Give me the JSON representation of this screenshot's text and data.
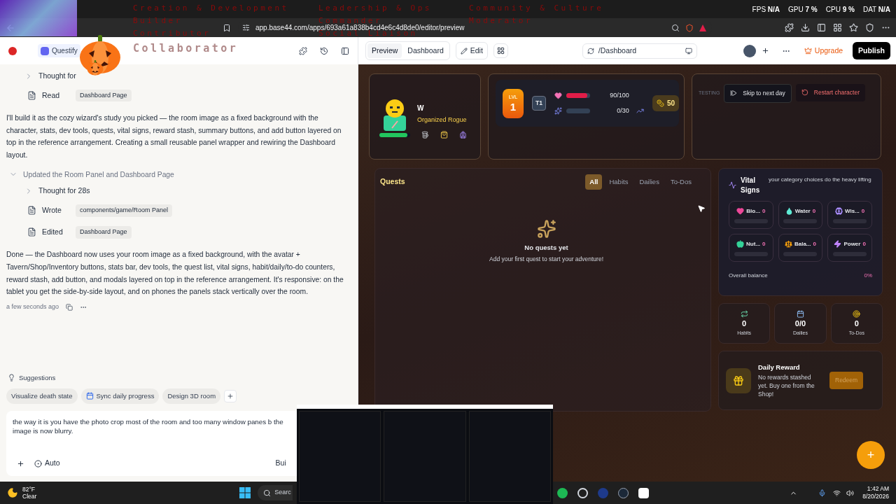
{
  "browser": {
    "perf": [
      {
        "label": "FPS",
        "value": "N/A"
      },
      {
        "label": "GPU",
        "value": "7 %"
      },
      {
        "label": "CPU",
        "value": "9 %"
      },
      {
        "label": "DAT",
        "value": "N/A"
      }
    ],
    "url": "app.base44.com/apps/693a61a838b4cd4e6c4d8de0/editor/preview"
  },
  "overlay": {
    "rows": [
      [
        "Creation & Development",
        "Leadership & Ops",
        "Community & Culture"
      ],
      [
        "Builder",
        "Commander",
        "Moderator"
      ],
      [
        "Contributor",
        "Social Liaison"
      ]
    ],
    "highlight": "Collaborator"
  },
  "appbar": {
    "project": "Questify",
    "view_toggle": [
      {
        "label": "Preview",
        "selected": true
      },
      {
        "label": "Dashboard",
        "selected": false
      }
    ],
    "edit": "Edit",
    "route": "/Dashboard",
    "upgrade": "Upgrade",
    "publish": "Publish"
  },
  "chat": {
    "items": [
      {
        "kind": "step",
        "label": "Thought for",
        "expanded": false
      },
      {
        "kind": "file",
        "action": "Read",
        "file": "Dashboard Page"
      },
      {
        "kind": "paragraph",
        "text": "I'll build it as the cozy wizard's study you picked — the room image as a fixed background with the character, stats, dev tools, quests, vital signs, reward stash, summary buttons, and add button layered on top in the reference arrangement. Creating a small reusable panel wrapper and rewiring the Dashboard layout."
      },
      {
        "kind": "group",
        "label": "Updated the Room Panel and Dashboard Page",
        "expanded": true,
        "children": [
          {
            "kind": "step",
            "label": "Thought for 28s",
            "expanded": false
          },
          {
            "kind": "file",
            "action": "Wrote",
            "file": "components/game/Room Panel"
          },
          {
            "kind": "file",
            "action": "Edited",
            "file": "Dashboard Page"
          }
        ]
      },
      {
        "kind": "paragraph",
        "text": "Done — the Dashboard now uses your room image as a fixed background, with the avatar + Tavern/Shop/Inventory buttons, stats bar, dev tools, the quest list, vital signs, habit/daily/to-do counters, reward stash, add button, and modals layered on top in the reference arrangement. It's responsive: on the tablet you get the side-by-side layout, and on phones the panels stack vertically over the room."
      }
    ],
    "timestamp": "a few seconds ago",
    "suggestions_title": "Suggestions",
    "suggestions": [
      "Visualize death state",
      "Sync daily progress",
      "Design 3D room"
    ],
    "input": {
      "value": "the way it is you have the photo crop most of the room and too many window panes b the image is now blurry.",
      "mode": "Auto",
      "send": "Bui"
    }
  },
  "preview": {
    "character": {
      "name": "W",
      "class": "Organized Rogue",
      "health": {
        "level": 0.9
      }
    },
    "stats": {
      "level_label": "LVL",
      "level": "1",
      "tier": "T1",
      "hp": {
        "level": 0.9,
        "reading": "90/100"
      },
      "xp": {
        "level": 0,
        "reading": "0/30"
      },
      "coins": "50"
    },
    "testing": {
      "label": "TESTING",
      "skip": "Skip to next day",
      "restart": "Restart character"
    },
    "quests": {
      "title": "Quests",
      "tabs": [
        {
          "label": "All",
          "selected": true
        },
        {
          "label": "Habits",
          "selected": false
        },
        {
          "label": "Dailies",
          "selected": false
        },
        {
          "label": "To-Dos",
          "selected": false
        }
      ],
      "empty_title": "No quests yet",
      "empty_text": "Add your first quest to start your adventure!"
    },
    "vitals": {
      "title": "Vital Signs",
      "subtitle": "your category choices do the heavy lifting",
      "items": [
        {
          "kind": "heart",
          "name": "Blo...",
          "value": "0",
          "level": 0,
          "color": "#ec4899"
        },
        {
          "kind": "drop",
          "name": "Water",
          "value": "0",
          "level": 0,
          "color": "#5eead4"
        },
        {
          "kind": "brain",
          "name": "Wis...",
          "value": "0",
          "level": 0,
          "color": "#a78bfa"
        },
        {
          "kind": "apple",
          "name": "Nut...",
          "value": "0",
          "level": 0,
          "color": "#34d399"
        },
        {
          "kind": "scale",
          "name": "Bala...",
          "value": "0",
          "level": 0,
          "color": "#f59e0b"
        },
        {
          "kind": "bolt",
          "name": "Power",
          "value": "0",
          "level": 0,
          "color": "#c084fc"
        }
      ],
      "overall_label": "Overall balance",
      "overall_value": "0%"
    },
    "counters": [
      {
        "kind": "repeat",
        "value": "0",
        "label": "Habits"
      },
      {
        "kind": "calendar",
        "value": "0/0",
        "label": "Dailies"
      },
      {
        "kind": "target",
        "value": "0",
        "label": "To-Dos"
      }
    ],
    "reward": {
      "title": "Daily Reward",
      "text": "No rewards stashed yet. Buy one from the Shop!",
      "button": "Redeem",
      "disabled": true
    },
    "fab": "+"
  },
  "taskbar": {
    "temp": "82°F",
    "weather": "Clear",
    "search": "Searc",
    "time": "1:42 AM",
    "date": "8/20/2026"
  }
}
